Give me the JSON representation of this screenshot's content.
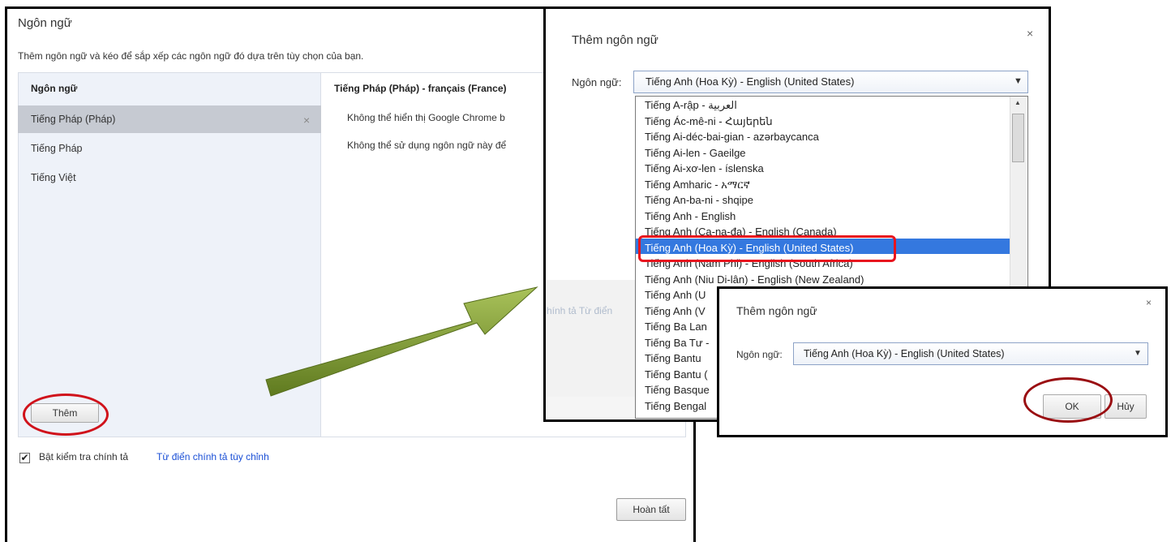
{
  "settings_panel": {
    "title": "Ngôn ngữ",
    "description": "Thêm ngôn ngữ và kéo để sắp xếp các ngôn ngữ đó dựa trên tùy chọn của bạn.",
    "list_header": "Ngôn ngữ",
    "languages": [
      "Tiếng Pháp (Pháp)",
      "Tiếng Pháp",
      "Tiếng Việt"
    ],
    "remove_symbol": "×",
    "add_button": "Thêm",
    "detail_title": "Tiếng Pháp (Pháp) - français (France)",
    "detail_line1": "Không thể hiển thị Google Chrome b",
    "detail_line2": "Không thể sử dụng ngôn ngữ này để",
    "spellcheck_label": "Bật kiểm tra chính tả",
    "spellcheck_checked": true,
    "custom_dictionary_link": "Từ điển chính tả tùy chỉnh",
    "background_spell_text": "hính tả  Từ điển",
    "done_button": "Hoàn tất"
  },
  "add_language_dialog": {
    "title": "Thêm ngôn ngữ",
    "close_symbol": "×",
    "language_label": "Ngôn ngữ:",
    "selected_value": "Tiếng Anh (Hoa Kỳ) - English (United States)",
    "options": [
      "Tiếng A-rập - العربية",
      "Tiếng Ác-mê-ni - Հայերեն",
      "Tiếng Ai-déc-bai-gian - azərbaycanca",
      "Tiếng Ai-len - Gaeilge",
      "Tiếng Ai-xơ-len - íslenska",
      "Tiếng Amharic - አማርኛ",
      "Tiếng An-ba-ni - shqipe",
      "Tiếng Anh - English",
      "Tiếng Anh (Ca-na-đa) - English (Canada)",
      "Tiếng Anh (Hoa Kỳ) - English (United States)",
      "Tiếng Anh (Nam Phi) - English (South Africa)",
      "Tiếng Anh (Niu Di-lân) - English (New Zealand)",
      "Tiếng Anh (U",
      "Tiếng Anh (V",
      "Tiếng Ba Lan",
      "Tiếng Ba Tư -",
      "Tiếng Bantu",
      "Tiếng Bantu (",
      "Tiếng Basque",
      "Tiếng Bengal"
    ],
    "highlighted_index": 9
  },
  "confirm_dialog": {
    "title": "Thêm ngôn ngữ",
    "close_symbol": "×",
    "language_label": "Ngôn ngữ:",
    "selected_value": "Tiếng Anh (Hoa Kỳ) - English (United States)",
    "ok_button": "OK",
    "cancel_button": "Hủy"
  },
  "colors": {
    "highlight_blue": "#3478df",
    "annotation_red": "#e8141e",
    "arrow_green": "#7a9a2e",
    "link_blue": "#1a4fd6"
  }
}
